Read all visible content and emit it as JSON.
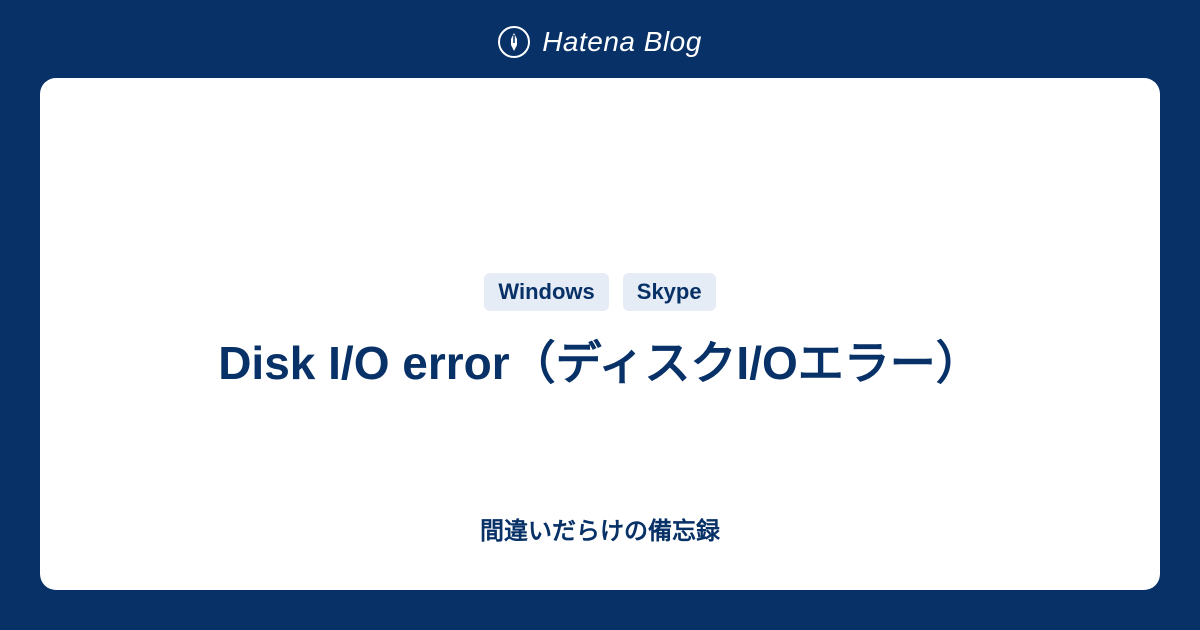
{
  "header": {
    "brand": "Hatena Blog"
  },
  "card": {
    "tags": [
      "Windows",
      "Skype"
    ],
    "title": "Disk I/O error（ディスクI/Oエラー）",
    "subtitle": "間違いだらけの備忘録"
  }
}
